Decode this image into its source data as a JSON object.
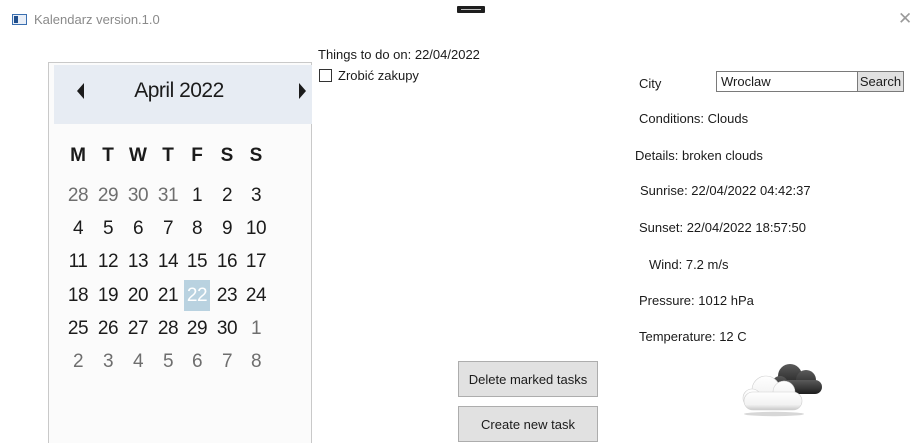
{
  "window": {
    "title": "Kalendarz version.1.0",
    "close_glyph": "✕"
  },
  "calendar": {
    "month_title": "April 2022",
    "weekdays": [
      "M",
      "T",
      "W",
      "T",
      "F",
      "S",
      "S"
    ],
    "weeks": [
      [
        {
          "d": "28",
          "other": true
        },
        {
          "d": "29",
          "other": true
        },
        {
          "d": "30",
          "other": true
        },
        {
          "d": "31",
          "other": true
        },
        {
          "d": "1"
        },
        {
          "d": "2"
        },
        {
          "d": "3"
        }
      ],
      [
        {
          "d": "4"
        },
        {
          "d": "5"
        },
        {
          "d": "6"
        },
        {
          "d": "7"
        },
        {
          "d": "8"
        },
        {
          "d": "9"
        },
        {
          "d": "10"
        }
      ],
      [
        {
          "d": "11"
        },
        {
          "d": "12"
        },
        {
          "d": "13"
        },
        {
          "d": "14"
        },
        {
          "d": "15"
        },
        {
          "d": "16"
        },
        {
          "d": "17"
        }
      ],
      [
        {
          "d": "18"
        },
        {
          "d": "19"
        },
        {
          "d": "20"
        },
        {
          "d": "21"
        },
        {
          "d": "22",
          "selected": true
        },
        {
          "d": "23"
        },
        {
          "d": "24"
        }
      ],
      [
        {
          "d": "25"
        },
        {
          "d": "26"
        },
        {
          "d": "27"
        },
        {
          "d": "28"
        },
        {
          "d": "29"
        },
        {
          "d": "30"
        },
        {
          "d": "1",
          "other": true
        }
      ],
      [
        {
          "d": "2",
          "other": true
        },
        {
          "d": "3",
          "other": true
        },
        {
          "d": "4",
          "other": true
        },
        {
          "d": "5",
          "other": true
        },
        {
          "d": "6",
          "other": true
        },
        {
          "d": "7",
          "other": true
        },
        {
          "d": "8",
          "other": true
        }
      ]
    ],
    "selected_color": "#b9d2e0"
  },
  "tasks": {
    "title": "Things to do on: 22/04/2022",
    "items": [
      {
        "label": "Zrobić zakupy",
        "checked": false
      }
    ],
    "delete_label": "Delete marked tasks",
    "create_label": "Create new task"
  },
  "weather": {
    "city_label": "City",
    "city_value": "Wroclaw",
    "search_label": "Search",
    "conditions": "Conditions: Clouds",
    "details": "Details: broken clouds",
    "sunrise": "Sunrise: 22/04/2022 04:42:37",
    "sunset": "Sunset: 22/04/2022 18:57:50",
    "wind": "Wind: 7.2 m/s",
    "pressure": "Pressure: 1012 hPa",
    "temperature": "Temperature: 12 C",
    "icon": "broken-clouds-icon"
  }
}
